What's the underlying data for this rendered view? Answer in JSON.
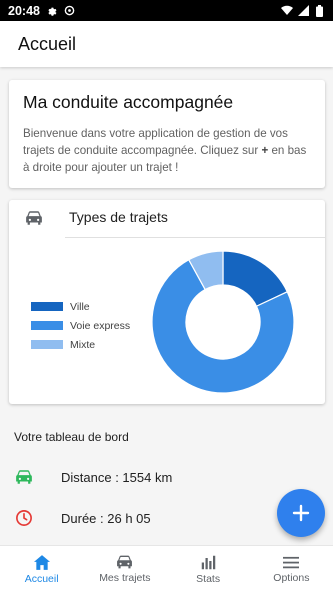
{
  "status_bar": {
    "time": "20:48"
  },
  "app_bar": {
    "title": "Accueil"
  },
  "welcome": {
    "title": "Ma conduite accompagnée",
    "text_before": "Bienvenue dans votre application de gestion de vos trajets de conduite accompagnée. Cliquez sur ",
    "text_bold": "+",
    "text_after": " en bas à droite pour ajouter un trajet !"
  },
  "chart_card": {
    "title": "Types de trajets",
    "icon": "car-icon"
  },
  "chart_data": {
    "type": "pie",
    "title": "Types de trajets",
    "donut": true,
    "categories": [
      "Ville",
      "Voie express",
      "Mixte"
    ],
    "values": [
      18,
      74,
      8
    ],
    "colors": [
      "#1565c0",
      "#3a8ee6",
      "#90bdf0"
    ],
    "legend_position": "left"
  },
  "dashboard": {
    "title": "Votre tableau de bord",
    "distance": {
      "label": "Distance : 1554 km",
      "icon": "car-icon",
      "color": "#2eb85c"
    },
    "duration": {
      "label": "Durée : 26 h 05",
      "icon": "clock-icon",
      "color": "#e53935"
    }
  },
  "fab": {
    "icon": "plus-icon",
    "color": "#2f80ed"
  },
  "bottom_nav": {
    "items": [
      {
        "label": "Accueil",
        "icon": "home-icon",
        "active": true
      },
      {
        "label": "Mes trajets",
        "icon": "car-icon",
        "active": false
      },
      {
        "label": "Stats",
        "icon": "bar-chart-icon",
        "active": false
      },
      {
        "label": "Options",
        "icon": "menu-icon",
        "active": false
      }
    ]
  }
}
